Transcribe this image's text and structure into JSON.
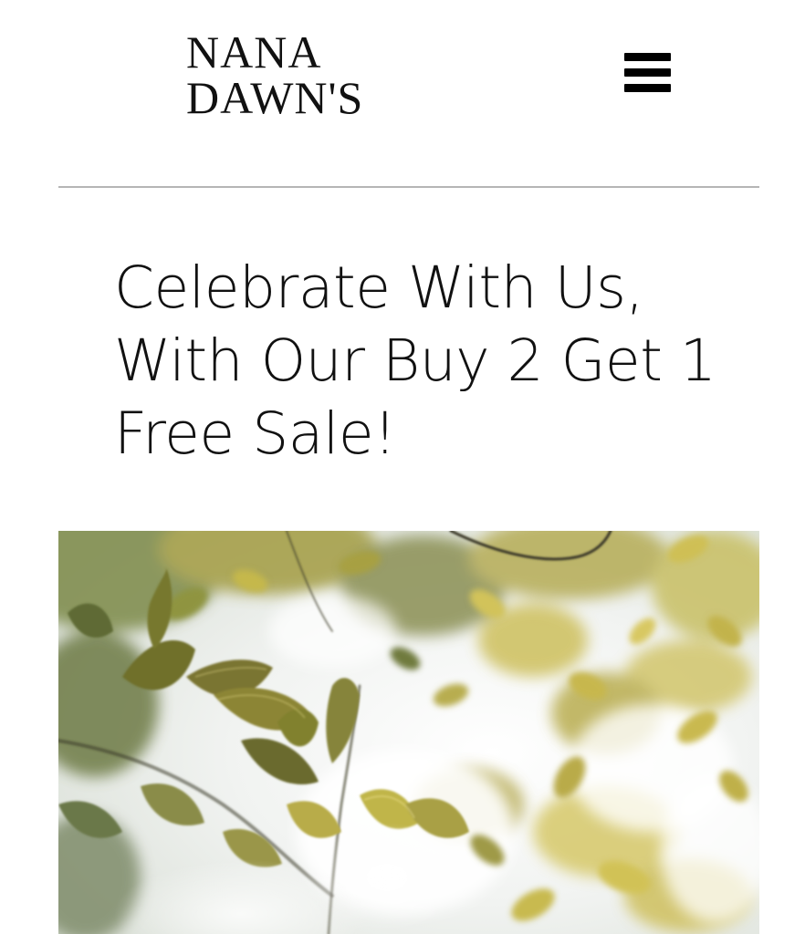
{
  "header": {
    "logo_line1": "NANA",
    "logo_line2": "DAWN'S",
    "menu_icon": "hamburger-menu-icon"
  },
  "main": {
    "headline": "Celebrate With Us, With Our Buy 2 Get 1 Free Sale!",
    "hero_image": "sunlit-leaves-photo"
  },
  "colors": {
    "text": "#111111",
    "divider": "#b5b5b5",
    "background": "#ffffff",
    "leaf_yellow": "#c9bd4a",
    "leaf_dark": "#4d5a2c",
    "sky": "#f2f4f3"
  }
}
